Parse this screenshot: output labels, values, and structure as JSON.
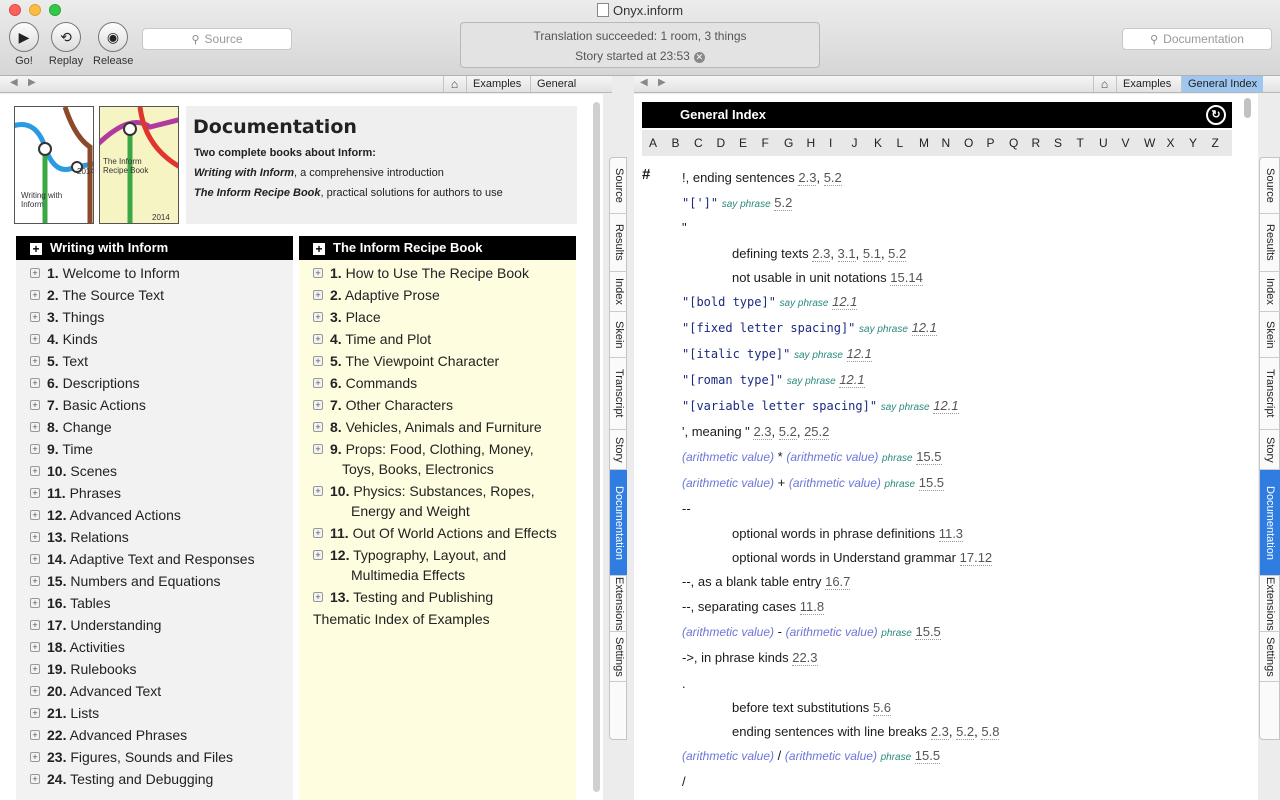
{
  "window": {
    "title": "Onyx.inform"
  },
  "toolbar": {
    "go_label": "Go!",
    "replay_label": "Replay",
    "release_label": "Release",
    "source_search_placeholder": "Source",
    "doc_search_placeholder": "Documentation"
  },
  "status": {
    "line1": "Translation succeeded: 1 room, 3 things",
    "line2": "Story started at 23:53"
  },
  "left_nav": {
    "links": [
      "Examples",
      "General Index"
    ]
  },
  "right_nav": {
    "links": [
      "Examples",
      "General Index"
    ],
    "active": "General Index"
  },
  "doc": {
    "title": "Documentation",
    "line1": "Two complete books about Inform:",
    "line2": "Writing with Inform, a comprehensive introduction",
    "line3": "The Inform Recipe Book, practical solutions for authors to use",
    "cover1_title": "Writing with Inform",
    "cover1_year": "2014",
    "cover2_title": "The Inform Recipe Book",
    "cover2_year": "2014"
  },
  "book1": {
    "title": "Writing with Inform",
    "chapters": [
      {
        "n": "1.",
        "t": "Welcome to Inform"
      },
      {
        "n": "2.",
        "t": "The Source Text"
      },
      {
        "n": "3.",
        "t": "Things"
      },
      {
        "n": "4.",
        "t": "Kinds"
      },
      {
        "n": "5.",
        "t": "Text"
      },
      {
        "n": "6.",
        "t": "Descriptions"
      },
      {
        "n": "7.",
        "t": "Basic Actions"
      },
      {
        "n": "8.",
        "t": "Change"
      },
      {
        "n": "9.",
        "t": "Time"
      },
      {
        "n": "10.",
        "t": "Scenes"
      },
      {
        "n": "11.",
        "t": "Phrases"
      },
      {
        "n": "12.",
        "t": "Advanced Actions"
      },
      {
        "n": "13.",
        "t": "Relations"
      },
      {
        "n": "14.",
        "t": "Adaptive Text and Responses"
      },
      {
        "n": "15.",
        "t": "Numbers and Equations"
      },
      {
        "n": "16.",
        "t": "Tables"
      },
      {
        "n": "17.",
        "t": "Understanding"
      },
      {
        "n": "18.",
        "t": "Activities"
      },
      {
        "n": "19.",
        "t": "Rulebooks"
      },
      {
        "n": "20.",
        "t": "Advanced Text"
      },
      {
        "n": "21.",
        "t": "Lists"
      },
      {
        "n": "22.",
        "t": "Advanced Phrases"
      },
      {
        "n": "23.",
        "t": "Figures, Sounds and Files"
      },
      {
        "n": "24.",
        "t": "Testing and Debugging"
      }
    ]
  },
  "book2": {
    "title": "The Inform Recipe Book",
    "chapters": [
      {
        "n": "1.",
        "t": "How to Use The Recipe Book"
      },
      {
        "n": "2.",
        "t": "Adaptive Prose"
      },
      {
        "n": "3.",
        "t": "Place"
      },
      {
        "n": "4.",
        "t": "Time and Plot"
      },
      {
        "n": "5.",
        "t": "The Viewpoint Character"
      },
      {
        "n": "6.",
        "t": "Commands"
      },
      {
        "n": "7.",
        "t": "Other Characters"
      },
      {
        "n": "8.",
        "t": "Vehicles, Animals and Furniture"
      },
      {
        "n": "9.",
        "t": "Props: Food, Clothing, Money,",
        "t2": "Toys, Books, Electronics"
      },
      {
        "n": "10.",
        "t": "Physics: Substances, Ropes,",
        "t2": "Energy and Weight"
      },
      {
        "n": "11.",
        "t": "Out Of World Actions and Effects"
      },
      {
        "n": "12.",
        "t": "Typography, Layout, and",
        "t2": "Multimedia Effects"
      },
      {
        "n": "13.",
        "t": "Testing and Publishing"
      }
    ],
    "thematic": "Thematic Index of Examples"
  },
  "side_tabs": [
    "Source",
    "Results",
    "Index",
    "Skein",
    "Transcript",
    "Story",
    "Documentation",
    "Extensions",
    "Settings"
  ],
  "side_tabs_active": "Documentation",
  "index": {
    "title": "General Index",
    "letters": [
      "A",
      "B",
      "C",
      "D",
      "E",
      "F",
      "G",
      "H",
      "I",
      "J",
      "K",
      "L",
      "M",
      "N",
      "O",
      "P",
      "Q",
      "R",
      "S",
      "T",
      "U",
      "V",
      "W",
      "X",
      "Y",
      "Z"
    ],
    "hash": "#",
    "say_phrase": "say phrase",
    "phrase": "phrase",
    "arith": "(arithmetic value)",
    "e1_text": "!, ending sentences",
    "e1_refs": [
      "2.3",
      "5.2"
    ],
    "e2_code": "\"[']\"",
    "e2_ref": "5.2",
    "e3_text": "\"",
    "e4_text": "defining texts",
    "e4_refs": [
      "2.3",
      "3.1",
      "5.1",
      "5.2"
    ],
    "e5_text": "not usable in unit notations",
    "e5_ref": "15.14",
    "e6_code": "\"[bold type]\"",
    "e6_ref": "12.1",
    "e7_code": "\"[fixed letter spacing]\"",
    "e7_ref": "12.1",
    "e8_code": "\"[italic type]\"",
    "e8_ref": "12.1",
    "e9_code": "\"[roman type]\"",
    "e9_ref": "12.1",
    "e10_code": "\"[variable letter spacing]\"",
    "e10_ref": "12.1",
    "e11_text": "', meaning \"",
    "e11_refs": [
      "2.3",
      "5.2",
      "25.2"
    ],
    "e12_op": "*",
    "e12_ref": "15.5",
    "e13_op": "+",
    "e13_ref": "15.5",
    "e14_text": "--",
    "e15_text": "optional words in phrase definitions",
    "e15_ref": "11.3",
    "e16_text": "optional words in Understand grammar",
    "e16_ref": "17.12",
    "e17_text": "--, as a blank table entry",
    "e17_ref": "16.7",
    "e18_text": "--, separating cases",
    "e18_ref": "11.8",
    "e19_op": "-",
    "e19_ref": "15.5",
    "e20_text": "->, in phrase kinds",
    "e20_ref": "22.3",
    "e21_text": ".",
    "e22_text": "before text substitutions",
    "e22_ref": "5.6",
    "e23_text": "ending sentences with line breaks",
    "e23_refs": [
      "2.3",
      "5.2",
      "5.8"
    ],
    "e24_op": "/",
    "e24_ref": "15.5",
    "e25_text": "/"
  }
}
